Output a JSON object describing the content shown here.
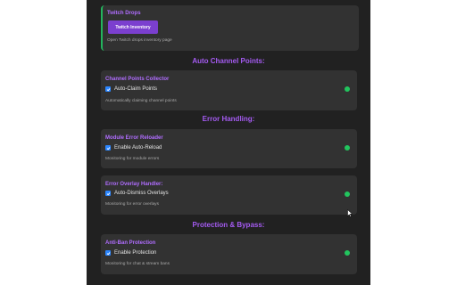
{
  "twitch_drops": {
    "title": "Twitch Drops",
    "button_label": "Twitch Inventory",
    "description": "Open Twitch drops inventory page"
  },
  "sections": {
    "auto_channel_points": "Auto Channel Points:",
    "error_handling": "Error Handling:",
    "protection_bypass": "Protection & Bypass:"
  },
  "cards": {
    "channel_points": {
      "title": "Channel Points Collector",
      "checkbox_label": "Auto-Claim Points",
      "checked": true,
      "description": "Automatically claiming channel points",
      "status_color": "#22c55e"
    },
    "module_error": {
      "title": "Module Error Reloader",
      "checkbox_label": "Enable Auto-Reload",
      "checked": true,
      "description": "Monitoring for module errors",
      "status_color": "#22c55e"
    },
    "error_overlay": {
      "title": "Error Overlay Handler:",
      "checkbox_label": "Auto-Dismiss Overlays",
      "checked": true,
      "description": "Monitoring for error overlays",
      "status_color": "#22c55e"
    },
    "anti_ban": {
      "title": "Anti-Ban Protection",
      "checkbox_label": "Enable Protection",
      "checked": true,
      "description": "Monitoring for chat & stream bans",
      "status_color": "#22c55e"
    }
  },
  "theme": {
    "accent_purple": "#a55bf2",
    "button_purple": "#7b3fcf",
    "status_green": "#22c55e",
    "checkbox_blue": "#2b86ff"
  }
}
